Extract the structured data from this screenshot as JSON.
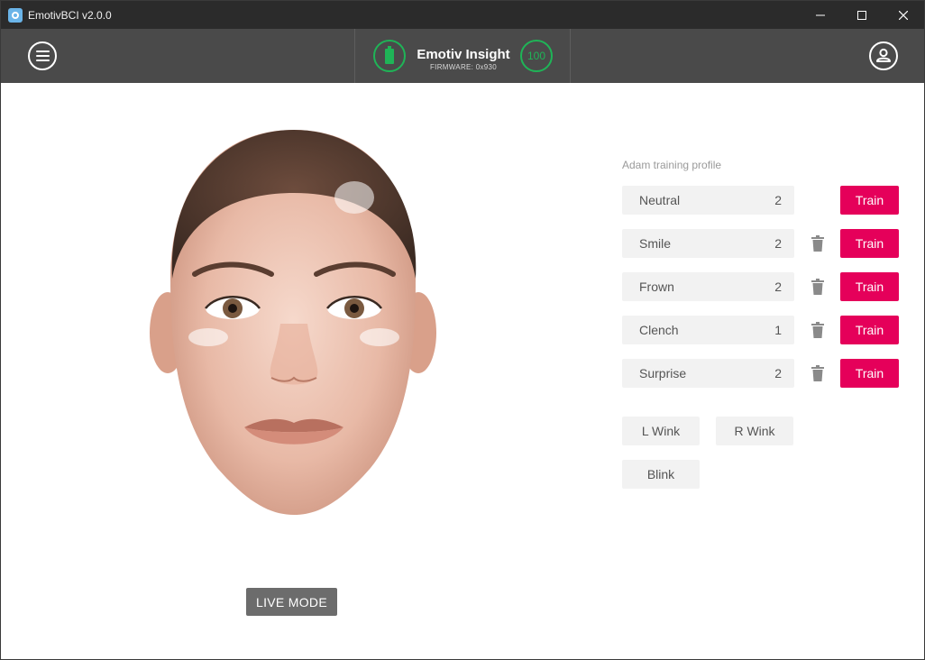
{
  "window": {
    "title": "EmotivBCI v2.0.0",
    "controls": {
      "minimize": "–",
      "maximize": "□",
      "close": "✕"
    }
  },
  "header": {
    "device_name": "Emotiv Insight",
    "firmware": "FIRMWARE: 0x930",
    "signal_quality": "100",
    "status_color": "#1fb457"
  },
  "profile": {
    "title": "Adam training profile",
    "actions": [
      {
        "label": "Neutral",
        "count": "2",
        "deletable": false,
        "train_label": "Train"
      },
      {
        "label": "Smile",
        "count": "2",
        "deletable": true,
        "train_label": "Train"
      },
      {
        "label": "Frown",
        "count": "2",
        "deletable": true,
        "train_label": "Train"
      },
      {
        "label": "Clench",
        "count": "1",
        "deletable": true,
        "train_label": "Train"
      },
      {
        "label": "Surprise",
        "count": "2",
        "deletable": true,
        "train_label": "Train"
      }
    ],
    "wink_left": "L Wink",
    "wink_right": "R Wink",
    "blink": "Blink",
    "accent_color": "#e5005a"
  },
  "live_mode_label": "LIVE MODE"
}
